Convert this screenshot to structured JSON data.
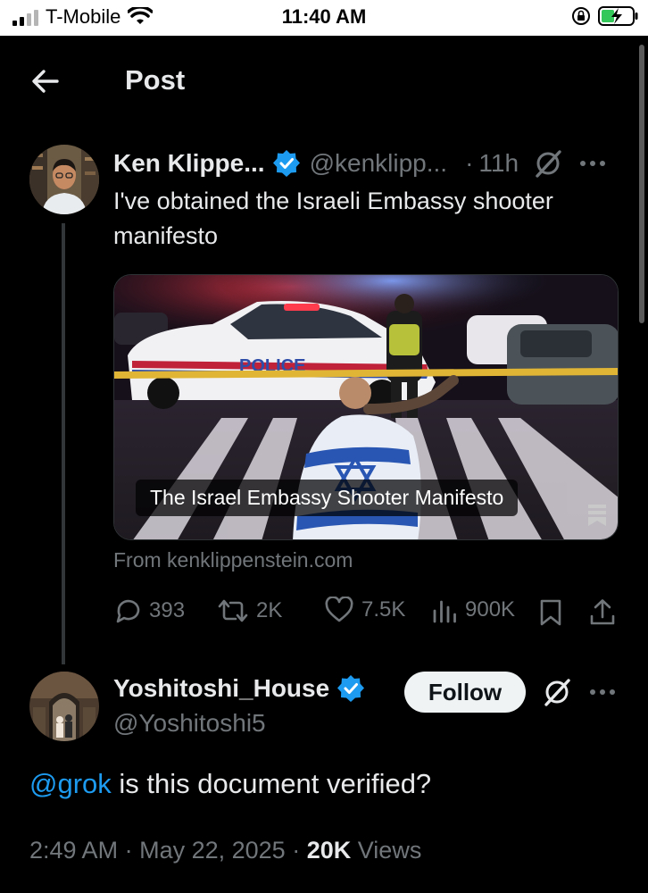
{
  "status_bar": {
    "carrier": "T-Mobile",
    "time": "11:40 AM",
    "signal_bars": 4,
    "signal_active": 2,
    "icons": [
      "wifi-icon",
      "orientation-lock-icon",
      "battery-charging-icon"
    ]
  },
  "header": {
    "title": "Post",
    "back_icon": "arrow-left-icon"
  },
  "post": {
    "display_name": "Ken Klippe...",
    "handle": "@kenklipp...",
    "time_separator": "·",
    "age": "11h",
    "verified": true,
    "text_line1": "I've obtained the Israeli Embassy shooter",
    "text_line2": "manifesto",
    "card": {
      "caption": "The Israel Embassy Shooter Manifesto",
      "from": "From kenklippenstein.com"
    },
    "actions": {
      "replies": "393",
      "reposts": "2K",
      "likes": "7.5K",
      "views": "900K"
    }
  },
  "reply": {
    "display_name": "Yoshitoshi_House",
    "handle": "@Yoshitoshi5",
    "verified": true,
    "follow_label": "Follow",
    "mention": "@grok",
    "text": " is this document verified?",
    "time": "2:49 AM",
    "date": "May 22, 2025",
    "separator": "·",
    "views_count": "20K",
    "views_label": "Views"
  },
  "colors": {
    "background": "#000000",
    "accent": "#1d9bf0",
    "secondary_text": "#71767b",
    "primary_text": "#e7e9ea"
  }
}
